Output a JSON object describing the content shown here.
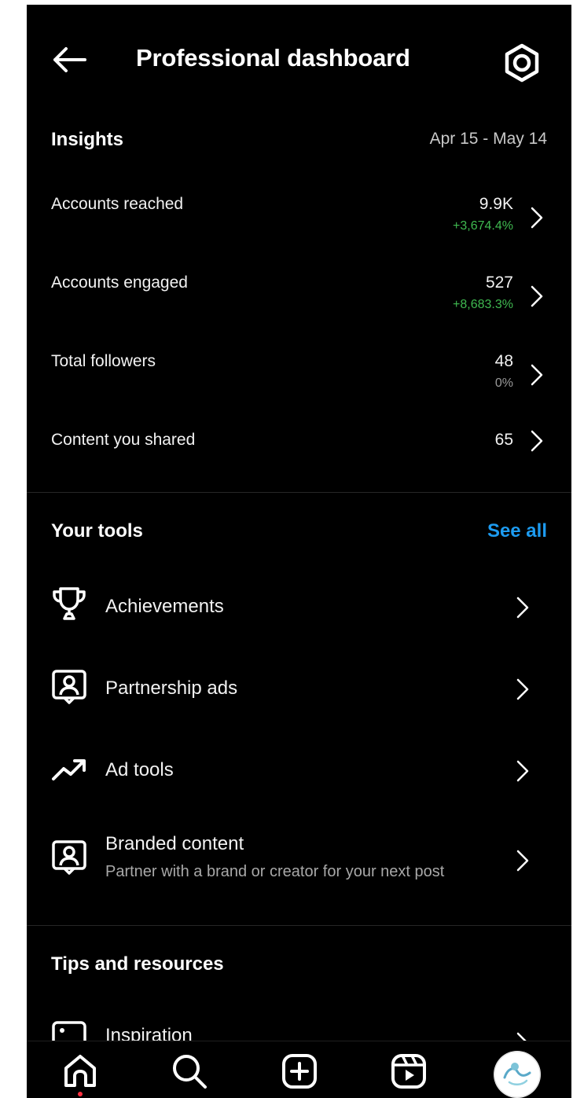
{
  "header": {
    "title": "Professional dashboard"
  },
  "insights": {
    "title": "Insights",
    "date_range": "Apr 15 - May 14",
    "metrics": [
      {
        "label": "Accounts reached",
        "value": "9.9K",
        "change": "+3,674.4%"
      },
      {
        "label": "Accounts engaged",
        "value": "527",
        "change": "+8,683.3%"
      },
      {
        "label": "Total followers",
        "value": "48",
        "change": "0%"
      },
      {
        "label": "Content you shared",
        "value": "65",
        "change": ""
      }
    ]
  },
  "tools": {
    "title": "Your tools",
    "see_all": "See all",
    "items": [
      {
        "label": "Achievements",
        "icon": "trophy-icon"
      },
      {
        "label": "Partnership ads",
        "icon": "person-badge-icon"
      },
      {
        "label": "Ad tools",
        "icon": "trending-up-icon"
      },
      {
        "label": "Branded content",
        "sub": "Partner with a brand or creator for your next post",
        "icon": "person-badge-icon"
      }
    ]
  },
  "tips": {
    "title": "Tips and resources",
    "items": [
      {
        "label": "Inspiration",
        "icon": "image-icon"
      }
    ]
  },
  "nav": {
    "items": [
      "home-icon",
      "search-icon",
      "create-icon",
      "reels-icon",
      "profile-avatar"
    ]
  },
  "colors": {
    "background": "#000000",
    "positive": "#3fb950",
    "accent": "#1d9bf0",
    "notification": "#ff3040"
  }
}
